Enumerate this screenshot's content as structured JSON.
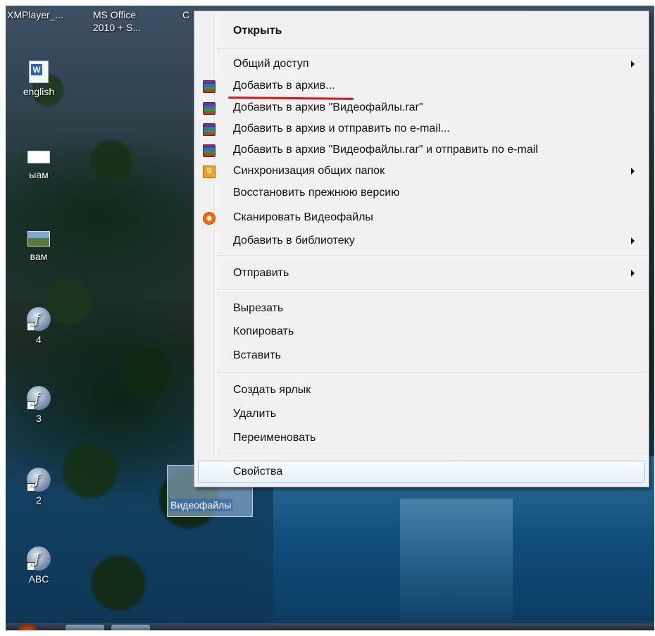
{
  "desktop": {
    "top_labels": [
      "XMPlayer_...",
      "MS Office",
      "2010 + S...",
      "C"
    ],
    "icons": [
      {
        "label": "english",
        "icon": "word-document-icon"
      },
      {
        "label": "ыам",
        "icon": "blank-file-icon"
      },
      {
        "label": "вам",
        "icon": "image-file-icon"
      },
      {
        "label": "4",
        "icon": "flash-shortcut-icon"
      },
      {
        "label": "3",
        "icon": "flash-shortcut-icon"
      },
      {
        "label": "2",
        "icon": "flash-shortcut-icon"
      },
      {
        "label": "ABC",
        "icon": "flash-shortcut-icon"
      }
    ],
    "selected_file": "Видеофайлы"
  },
  "menu": {
    "items": [
      {
        "label": "Открыть",
        "bold": true
      },
      {
        "label": "Общий доступ",
        "submenu": true
      },
      {
        "label": "Добавить в архив...",
        "icon": "winrar-icon"
      },
      {
        "label": "Добавить в архив \"Видеофайлы.rar\"",
        "icon": "winrar-icon"
      },
      {
        "label": "Добавить в архив и отправить по e-mail...",
        "icon": "winrar-icon"
      },
      {
        "label": "Добавить в архив \"Видеофайлы.rar\" и отправить по e-mail",
        "icon": "winrar-icon"
      },
      {
        "label": "Синхронизация общих папок",
        "icon": "sync-icon",
        "submenu": true
      },
      {
        "label": "Восстановить прежнюю версию"
      },
      {
        "label": "Сканировать Видеофайлы",
        "icon": "antivirus-scan-icon"
      },
      {
        "label": "Добавить в библиотеку",
        "submenu": true
      },
      {
        "label": "Отправить",
        "submenu": true
      },
      {
        "label": "Вырезать"
      },
      {
        "label": "Копировать"
      },
      {
        "label": "Вставить"
      },
      {
        "label": "Создать ярлык"
      },
      {
        "label": "Удалить"
      },
      {
        "label": "Переименовать"
      },
      {
        "label": "Свойства",
        "highlighted": true
      }
    ],
    "sync_glyph": "S",
    "colors": {
      "menu_bg": "#f1f1f1",
      "highlight_border": "#a8c8e8",
      "annotation": "#d8141a"
    }
  }
}
